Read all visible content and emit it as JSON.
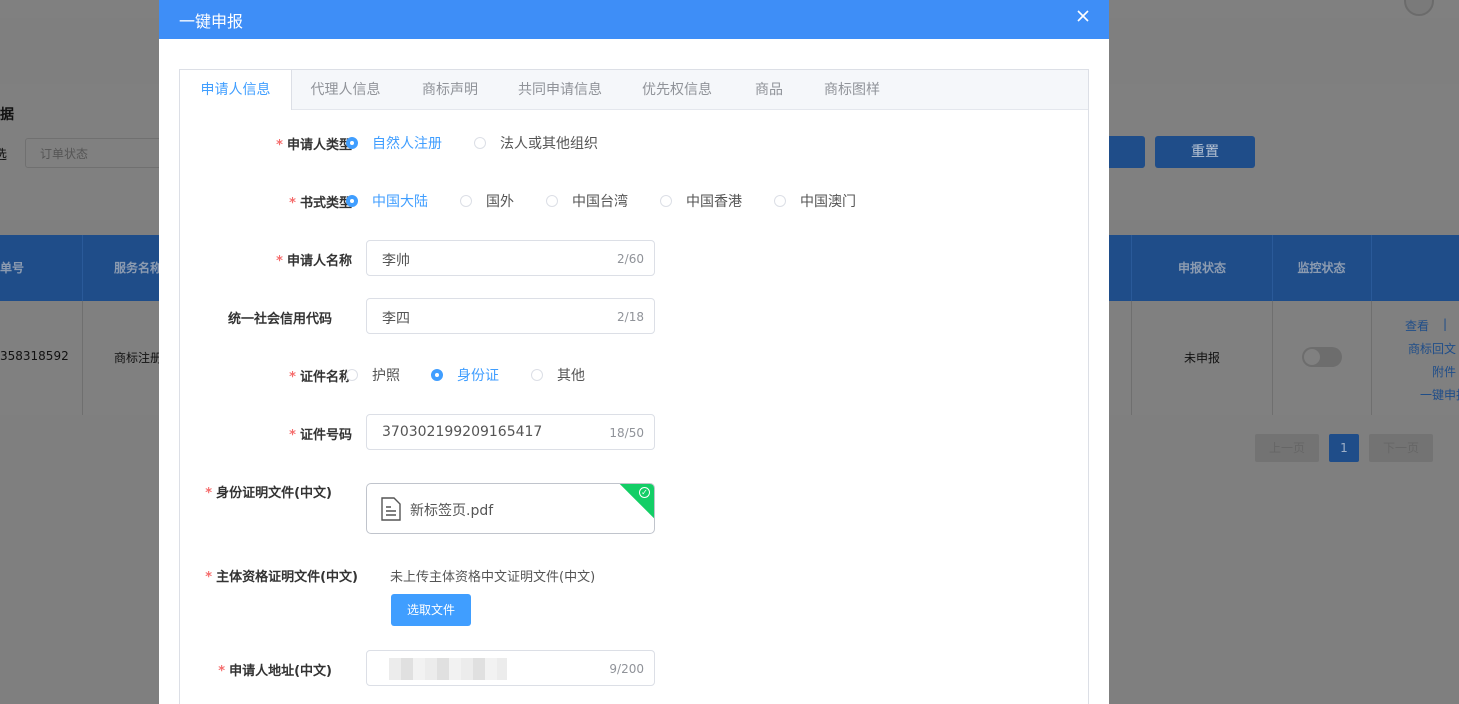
{
  "background": {
    "section_title": "据",
    "filter_label": "选",
    "filter_placeholder": "订单状态",
    "query_button": "",
    "reset_button": "重置",
    "table_headers": [
      "单号",
      "服务名称",
      "申报状态",
      "监控状态"
    ],
    "row": {
      "order_no": "358318592",
      "service": "商标注册",
      "report_status": "未申报",
      "monitor_on": false,
      "actions": [
        "查看",
        "|",
        "商标回文",
        "附件",
        "一键申报"
      ]
    },
    "pagination": {
      "prev": "上一页",
      "current": "1",
      "next": "下一页"
    }
  },
  "modal": {
    "title": "一键申报",
    "close_icon": "close-icon",
    "tabs": [
      {
        "label": "申请人信息",
        "active": true
      },
      {
        "label": "代理人信息",
        "active": false
      },
      {
        "label": "商标声明",
        "active": false
      },
      {
        "label": "共同申请信息",
        "active": false
      },
      {
        "label": "优先权信息",
        "active": false
      },
      {
        "label": "商品",
        "active": false
      },
      {
        "label": "商标图样",
        "active": false
      }
    ],
    "form": {
      "applicant_type": {
        "label": "申请人类型",
        "required": true,
        "options": [
          "自然人注册",
          "法人或其他组织"
        ],
        "selected": "自然人注册"
      },
      "format_type": {
        "label": "书式类型",
        "required": true,
        "options": [
          "中国大陆",
          "国外",
          "中国台湾",
          "中国香港",
          "中国澳门"
        ],
        "selected": "中国大陆"
      },
      "applicant_name": {
        "label": "申请人名称",
        "required": true,
        "value": "李帅",
        "count": "2/60"
      },
      "credit_code": {
        "label": "统一社会信用代码",
        "required": false,
        "value": "李四",
        "count": "2/18"
      },
      "cert_name": {
        "label": "证件名称",
        "required": true,
        "options": [
          "护照",
          "身份证",
          "其他"
        ],
        "selected": "身份证"
      },
      "cert_no": {
        "label": "证件号码",
        "required": true,
        "value": "370302199209165417",
        "count": "18/50"
      },
      "id_doc": {
        "label": "身份证明文件(中文)",
        "required": true,
        "file_name": "新标签页.pdf",
        "file_icon": "document-icon",
        "status_icon": "check-circle-icon"
      },
      "subject_doc": {
        "label": "主体资格证明文件(中文)",
        "required": true,
        "hint": "未上传主体资格中文证明文件(中文)",
        "button": "选取文件"
      },
      "address": {
        "label": "申请人地址(中文)",
        "required": true,
        "value": "",
        "count": "9/200"
      }
    }
  },
  "colors": {
    "primary": "#409eff",
    "header": "#3e8ef7",
    "required": "#f56c6c",
    "success": "#13ce66"
  }
}
